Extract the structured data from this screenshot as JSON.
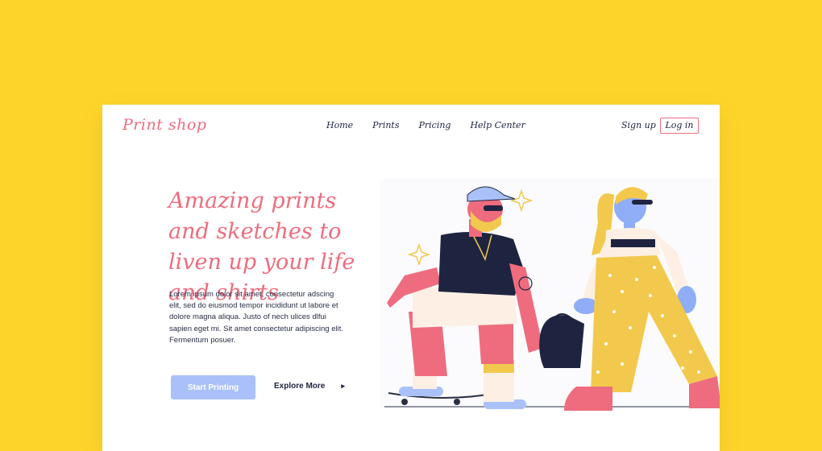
{
  "brand": {
    "logo_text": "Print shop",
    "color": "#EE6C7E"
  },
  "nav": {
    "items": [
      "Home",
      "Prints",
      "Pricing",
      "Help Center"
    ]
  },
  "auth": {
    "signup_label": "Sign up",
    "login_label": "Log in"
  },
  "hero": {
    "headline": "Amazing prints and sketches to liven up your life and shirts",
    "body": "Lorem ipsum dolor sit amet, consectetur adscing elit, sed do eiusmod tempor incididunt ut labore et dolore magna aliqua. Justo of nech ulices dlfui sapien eget mi. Sit amet consectetur adipiscing elit. Fermentum posuer.",
    "primary_cta": "Start Printing",
    "secondary_cta": "Explore More",
    "secondary_icon": "chevron-right-icon"
  },
  "colors": {
    "background": "#FDD52A",
    "accent": "#EE6C7E",
    "primary_button": "#A9C1F8",
    "text_dark": "#1E2440"
  }
}
